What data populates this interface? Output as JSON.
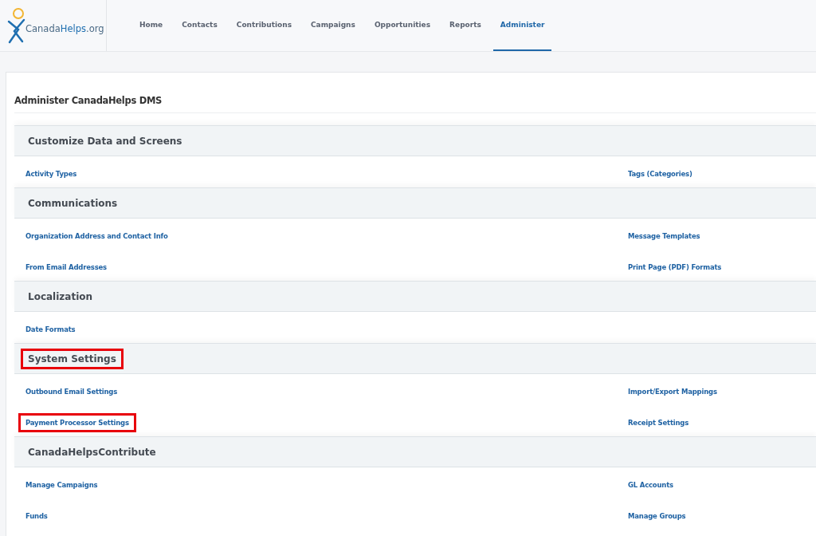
{
  "logo": {
    "text_plain": "Canada",
    "text_accent": "Helps",
    ".org": ".org"
  },
  "nav": [
    {
      "label": "Home",
      "selected": false
    },
    {
      "label": "Contacts",
      "selected": false
    },
    {
      "label": "Contributions",
      "selected": false
    },
    {
      "label": "Campaigns",
      "selected": false
    },
    {
      "label": "Opportunities",
      "selected": false
    },
    {
      "label": "Reports",
      "selected": false
    },
    {
      "label": "Administer",
      "selected": true
    }
  ],
  "page_title": "Administer CanadaHelps DMS",
  "sections": [
    {
      "title": "Customize Data and Screens",
      "highlighted": false,
      "rows": [
        [
          {
            "label": "Activity Types",
            "highlighted": false
          },
          {
            "label": "Tags (Categories)",
            "highlighted": false
          }
        ]
      ]
    },
    {
      "title": "Communications",
      "highlighted": false,
      "rows": [
        [
          {
            "label": "Organization Address and Contact Info",
            "highlighted": false
          },
          {
            "label": "Message Templates",
            "highlighted": false
          }
        ],
        [
          {
            "label": "From Email Addresses",
            "highlighted": false
          },
          {
            "label": "Print Page (PDF) Formats",
            "highlighted": false
          }
        ]
      ]
    },
    {
      "title": "Localization",
      "highlighted": false,
      "rows": [
        [
          {
            "label": "Date Formats",
            "highlighted": false
          }
        ]
      ]
    },
    {
      "title": "System Settings",
      "highlighted": true,
      "rows": [
        [
          {
            "label": "Outbound Email Settings",
            "highlighted": false
          },
          {
            "label": "Import/Export Mappings",
            "highlighted": false
          }
        ],
        [
          {
            "label": "Payment Processor Settings",
            "highlighted": true
          },
          {
            "label": "Receipt Settings",
            "highlighted": false
          }
        ]
      ]
    },
    {
      "title": "CanadaHelpsContribute",
      "highlighted": false,
      "rows": [
        [
          {
            "label": "Manage Campaigns",
            "highlighted": false
          },
          {
            "label": "GL Accounts",
            "highlighted": false
          }
        ],
        [
          {
            "label": "Funds",
            "highlighted": false
          },
          {
            "label": "Manage Groups",
            "highlighted": false
          }
        ]
      ]
    }
  ]
}
